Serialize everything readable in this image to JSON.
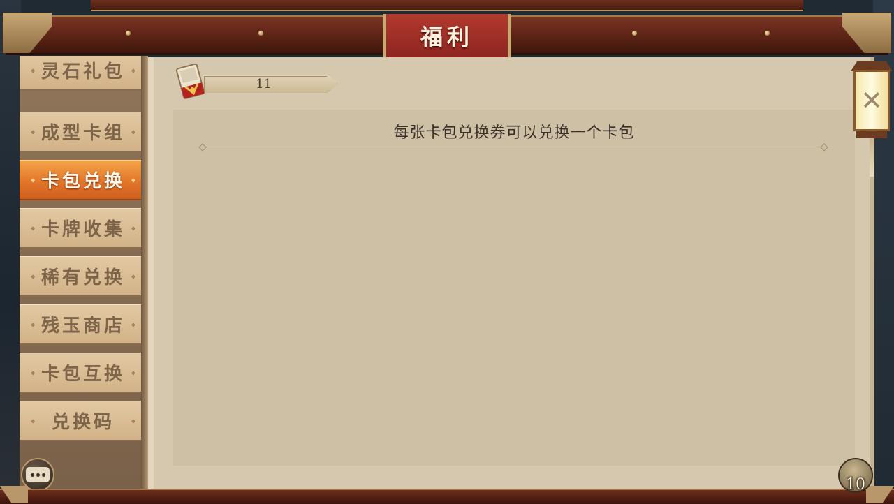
{
  "header": {
    "title": "福利"
  },
  "sidebar": {
    "items": [
      {
        "label": "灵石礼包",
        "active": false
      },
      {
        "label": "成型卡组",
        "active": false
      },
      {
        "label": "卡包兑换",
        "active": true
      },
      {
        "label": "卡牌收集",
        "active": false
      },
      {
        "label": "稀有兑换",
        "active": false
      },
      {
        "label": "残玉商店",
        "active": false
      },
      {
        "label": "卡包互换",
        "active": false
      },
      {
        "label": "兑换码",
        "active": false
      }
    ]
  },
  "main": {
    "voucher_count": "11",
    "description": "每张卡包兑换券可以兑换一个卡包"
  },
  "footer": {
    "coin_count": "10"
  },
  "icons": {
    "close": "close-icon",
    "chat": "chat-icon",
    "voucher": "card-pack-voucher-icon",
    "coin": "coin-stack-icon"
  },
  "colors": {
    "active_tab": "#e2762a",
    "title_plaque": "#a3302a",
    "panel_bg": "#d5c8ae"
  }
}
